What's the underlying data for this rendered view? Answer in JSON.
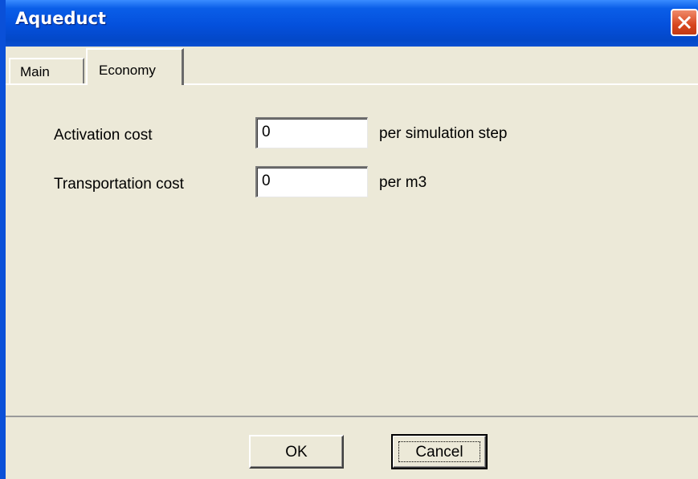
{
  "window": {
    "title": "Aqueduct"
  },
  "tabs": [
    {
      "label": "Main"
    },
    {
      "label": "Economy"
    }
  ],
  "form": {
    "activation": {
      "label": "Activation cost",
      "value": "0",
      "unit": "per simulation step"
    },
    "transportation": {
      "label": "Transportation cost",
      "value": "0",
      "unit": "per m3"
    }
  },
  "buttons": {
    "ok": "OK",
    "cancel": "Cancel"
  },
  "icons": {
    "close": "close-icon"
  },
  "colors": {
    "titlebar": "#0450dc",
    "window_bg": "#ece9d8",
    "close_button": "#d8461e"
  }
}
